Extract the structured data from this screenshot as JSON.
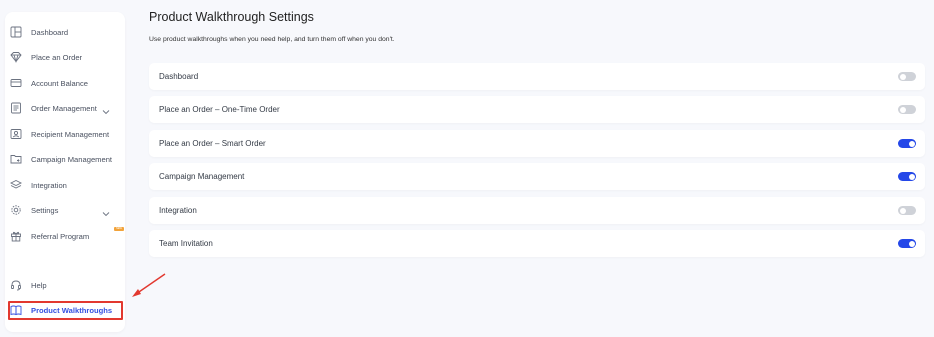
{
  "sidebar": {
    "items": [
      {
        "label": "Dashboard",
        "icon": "dashboard-icon"
      },
      {
        "label": "Place an Order",
        "icon": "diamond-icon"
      },
      {
        "label": "Account Balance",
        "icon": "card-icon"
      },
      {
        "label": "Order Management",
        "icon": "list-icon"
      },
      {
        "label": "Recipient Management",
        "icon": "contact-icon"
      },
      {
        "label": "Campaign Management",
        "icon": "folder-icon"
      },
      {
        "label": "Integration",
        "icon": "layers-icon"
      },
      {
        "label": "Settings",
        "icon": "gear-icon"
      },
      {
        "label": "Referral Program",
        "icon": "gift-icon"
      },
      {
        "label": "Help",
        "icon": "headset-icon"
      },
      {
        "label": "Product Walkthroughs",
        "icon": "book-icon"
      }
    ],
    "new_badge": "NEW"
  },
  "main": {
    "title": "Product Walkthrough Settings",
    "description": "Use product walkthroughs when you need help, and turn them off when you don't.",
    "settings": [
      {
        "label": "Dashboard",
        "enabled": false
      },
      {
        "label": "Place an Order – One-Time Order",
        "enabled": false
      },
      {
        "label": "Place an Order – Smart Order",
        "enabled": true
      },
      {
        "label": "Campaign Management",
        "enabled": true
      },
      {
        "label": "Integration",
        "enabled": false
      },
      {
        "label": "Team Invitation",
        "enabled": true
      }
    ]
  },
  "colors": {
    "accent": "#2447e8",
    "toggle_off": "#cfd2d8",
    "highlight": "#e2382f",
    "badge": "#f2a33a"
  }
}
